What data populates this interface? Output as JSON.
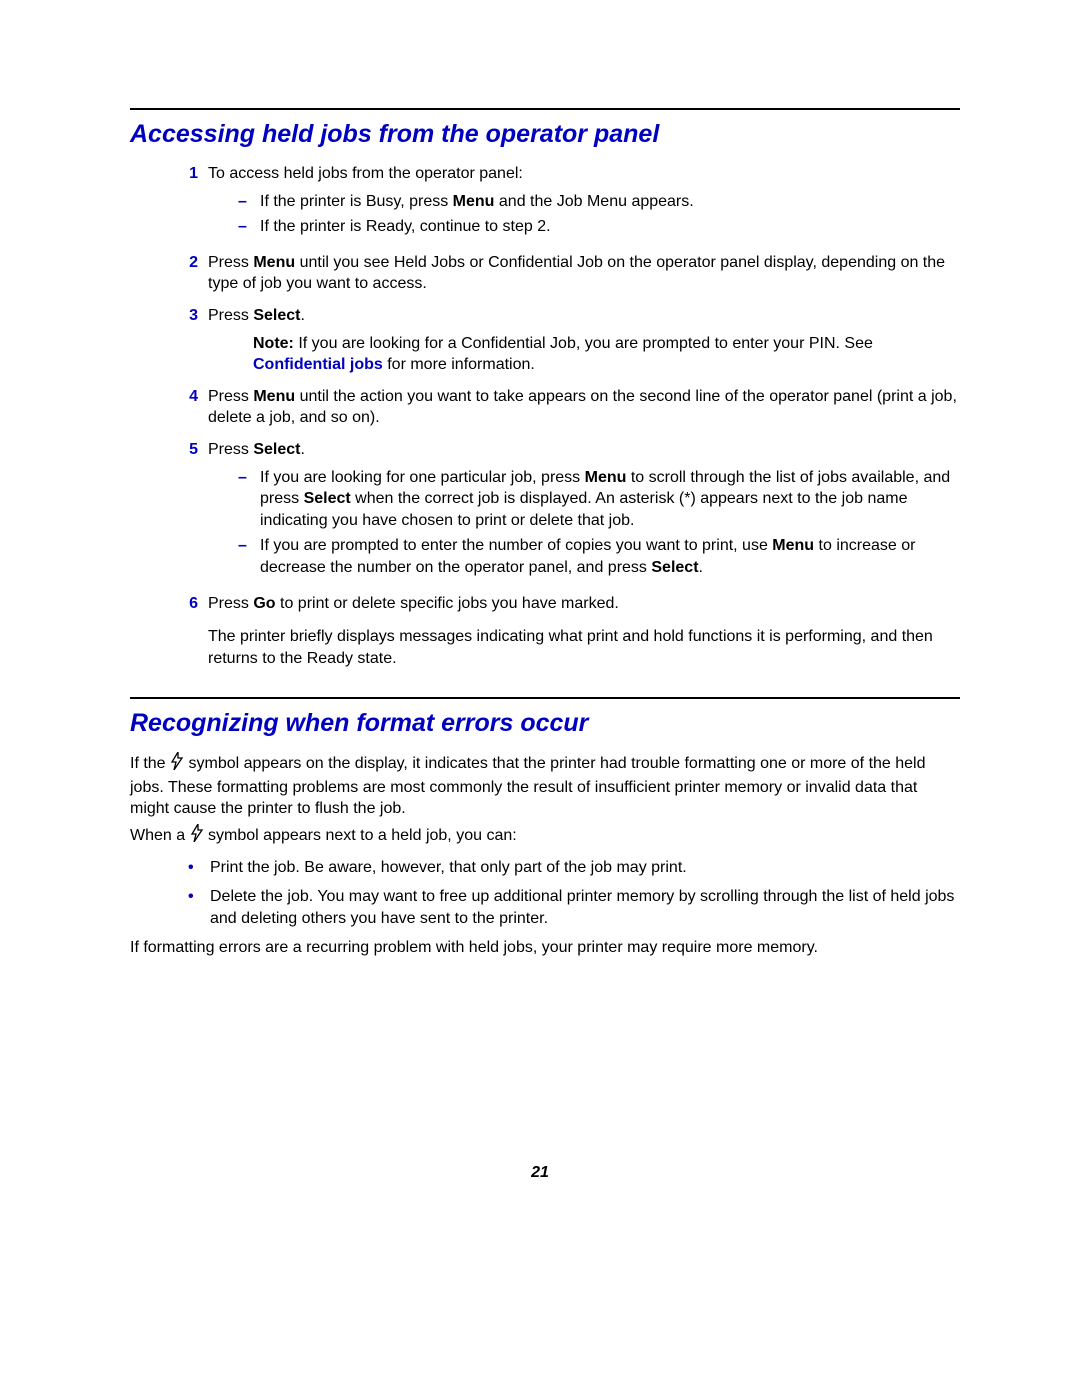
{
  "section1": {
    "title": "Accessing held jobs from the operator panel",
    "items": [
      {
        "num": "1",
        "text": "To access held jobs from the operator panel:",
        "subs": [
          {
            "pre": "If the printer is Busy, press ",
            "bold1": "Menu",
            "post": " and the Job Menu appears."
          },
          {
            "pre": "If the printer is Ready, continue to step 2.",
            "bold1": "",
            "post": ""
          }
        ]
      },
      {
        "num": "2",
        "pre": "Press ",
        "bold1": "Menu",
        "post": " until you see Held Jobs or Confidential Job on the operator panel display, depending on the type of job you want to access."
      },
      {
        "num": "3",
        "pre": "Press ",
        "bold1": "Select",
        "post": ".",
        "note": {
          "label": "Note:",
          "pre": " If you are looking for a Confidential Job, you are prompted to enter your PIN. See ",
          "link": "Confidential jobs",
          "post": " for more information."
        }
      },
      {
        "num": "4",
        "pre": "Press ",
        "bold1": "Menu",
        "post": " until the action you want to take appears on the second line of the operator panel (print a job, delete a job, and so on)."
      },
      {
        "num": "5",
        "pre": "Press ",
        "bold1": "Select",
        "post": ".",
        "subs": [
          {
            "pre": "If you are looking for one particular job, press ",
            "bold1": "Menu",
            "mid1": " to scroll through the list of jobs available, and press ",
            "bold2": "Select",
            "post": " when the correct job is displayed. An asterisk (*) appears next to the job name indicating you have chosen to print or delete that job."
          },
          {
            "pre": "If you are prompted to enter the number of copies you want to print, use ",
            "bold1": "Menu",
            "mid1": " to increase or decrease the number on the operator panel, and press ",
            "bold2": "Select",
            "post": "."
          }
        ]
      },
      {
        "num": "6",
        "pre": "Press ",
        "bold1": "Go",
        "post": " to print or delete specific jobs you have marked.",
        "tail": "The printer briefly displays messages indicating what print and hold functions it is performing, and then returns to the Ready state."
      }
    ]
  },
  "section2": {
    "title": "Recognizing when format errors occur",
    "para1_pre": "If the ",
    "para1_post": " symbol appears on the display, it indicates that the printer had trouble formatting one or more of the held jobs. These formatting problems are most commonly the result of insufficient printer memory or invalid data that might cause the printer to flush the job.",
    "para2_pre": "When a ",
    "para2_post": " symbol appears next to a held job, you can:",
    "bullets": [
      "Print the job. Be aware, however, that only part of the job may print.",
      "Delete the job. You may want to free up additional printer memory by scrolling through the list of held jobs and deleting others you have sent to the printer."
    ],
    "para3": "If formatting errors are a recurring problem with held jobs, your printer may require more memory."
  },
  "page_number": "21"
}
